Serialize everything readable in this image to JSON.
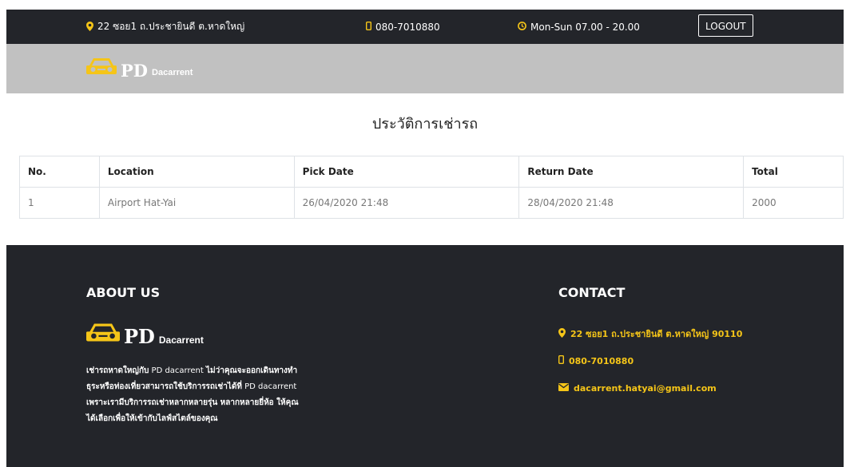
{
  "topbar": {
    "address": "22 ซอย1 ถ.ประชายินดี ต.หาดใหญ่",
    "phone": "080-7010880",
    "hours": "Mon-Sun 07.00 - 20.00",
    "logout_label": "LOGOUT"
  },
  "brand": {
    "name": "PD",
    "sub": "Dacarrent"
  },
  "page": {
    "title": "ประวัติการเช่ารถ"
  },
  "table": {
    "headers": [
      "No.",
      "Location",
      "Pick Date",
      "Return Date",
      "Total"
    ],
    "rows": [
      [
        "1",
        "Airport Hat-Yai",
        "26/04/2020 21:48",
        "28/04/2020 21:48",
        "2000"
      ]
    ]
  },
  "footer": {
    "about_title": "ABOUT US",
    "about_text": [
      "เช่ารถหาดใหญ่กับ",
      " PD dacarrent ",
      "ไม่ว่าคุณจะออกเดินทางทำธุระหรือท่องเที่ยวสามารถใช้บริการรถเช่าได้ที่",
      " PD dacarrent ",
      "เพราะเรามีบริการรถเช่าหลากหลายรุ่น หลากหลายยี่ห้อ ให้คุณได้เลือกเพื่อให้เข้ากับไลฟ์สไตล์ของคุณ"
    ],
    "contact_title": "CONTACT",
    "contact": {
      "address": "22 ซอย1 ถ.ประชายินดี ต.หาดใหญ่ 90110",
      "phone": "080-7010880",
      "email": "dacarrent.hatyai@gmail.com"
    }
  },
  "colors": {
    "accent": "#f5c518",
    "dark": "#23252a",
    "header": "#c1c1c1"
  }
}
